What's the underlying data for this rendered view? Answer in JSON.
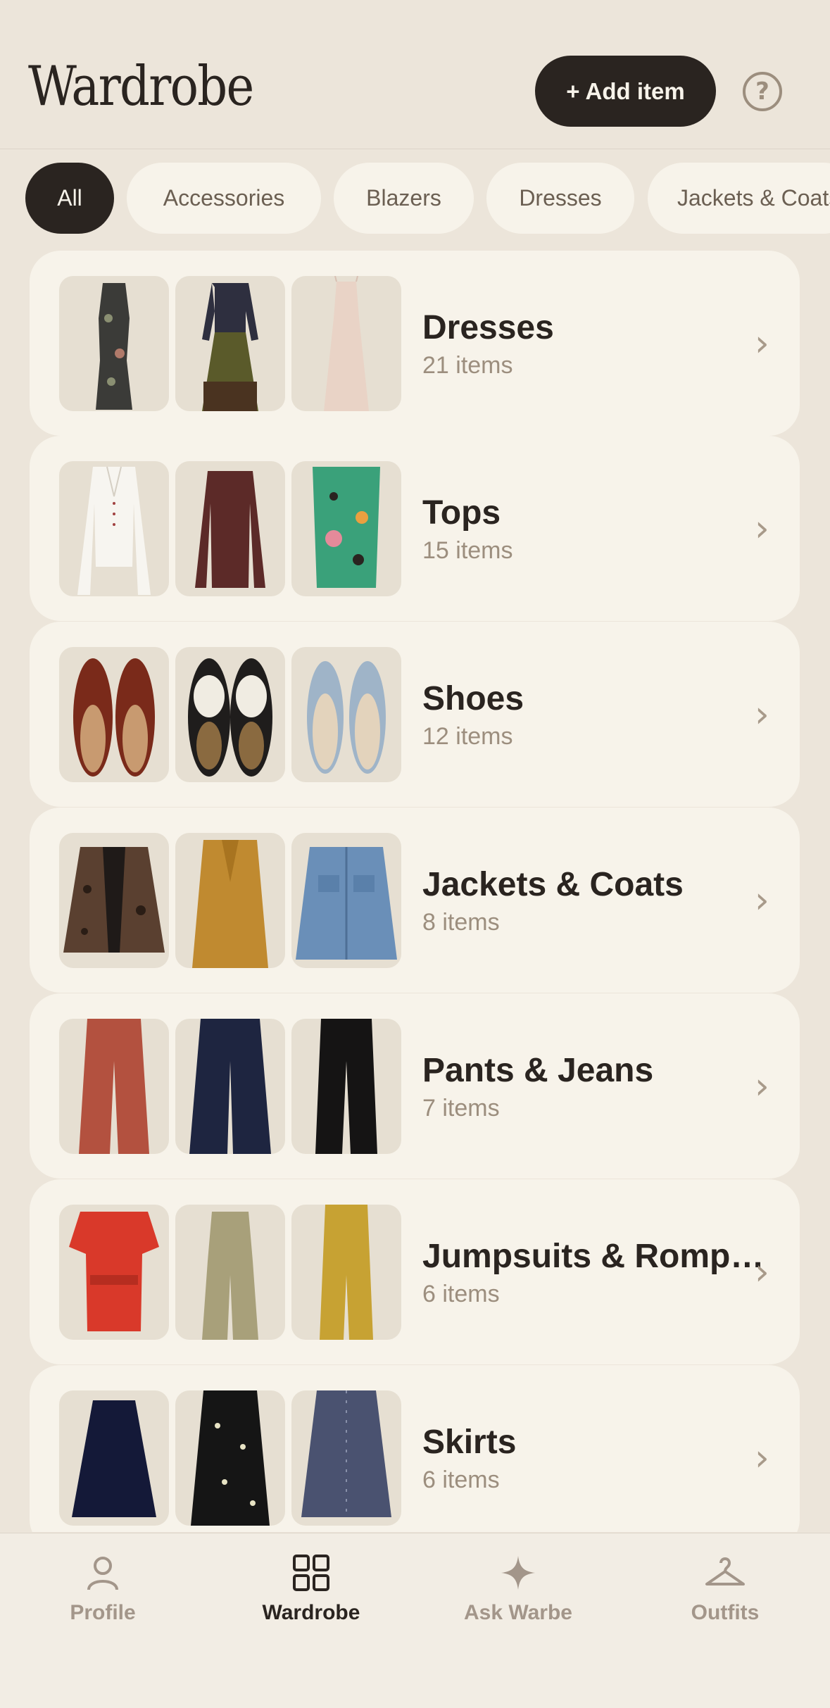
{
  "header": {
    "title": "Wardrobe",
    "add_label": "+ Add item",
    "help_icon": "help-circle-icon"
  },
  "filters": [
    {
      "label": "All",
      "active": true
    },
    {
      "label": "Accessories",
      "active": false
    },
    {
      "label": "Blazers",
      "active": false
    },
    {
      "label": "Dresses",
      "active": false
    },
    {
      "label": "Jackets & Coats",
      "active": false
    }
  ],
  "categories": [
    {
      "name": "Dresses",
      "count": "21 items"
    },
    {
      "name": "Tops",
      "count": "15 items"
    },
    {
      "name": "Shoes",
      "count": "12 items"
    },
    {
      "name": "Jackets & Coats",
      "count": "8 items"
    },
    {
      "name": "Pants & Jeans",
      "count": "7 items"
    },
    {
      "name": "Jumpsuits & Romp…",
      "count": "6 items"
    },
    {
      "name": "Skirts",
      "count": "6 items"
    }
  ],
  "tabs": [
    {
      "label": "Profile",
      "icon": "person-icon",
      "active": false
    },
    {
      "label": "Wardrobe",
      "icon": "grid-icon",
      "active": true
    },
    {
      "label": "Ask Warbe",
      "icon": "sparkle-icon",
      "active": false
    },
    {
      "label": "Outfits",
      "icon": "hanger-icon",
      "active": false
    }
  ],
  "colors": {
    "background": "#ece5da",
    "card": "#f7f3ea",
    "ink": "#2a2420",
    "muted": "#9c8e7e"
  }
}
